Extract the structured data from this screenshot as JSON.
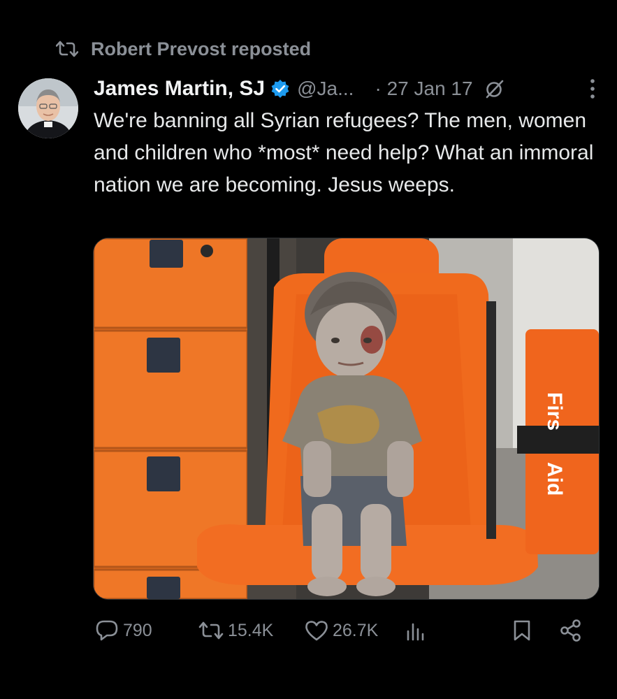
{
  "repost": {
    "label": "Robert Prevost reposted",
    "icon": "repost-icon"
  },
  "tweet": {
    "author_name": "James Martin, SJ",
    "verified": true,
    "handle": "@Ja...",
    "date": "· 27 Jan 17",
    "text": "We're banning all Syrian refugees? The men, women and children who *most* need help? What an immoral nation we are becoming. Jesus weeps.",
    "image": {
      "sign_text_top": "Firs",
      "sign_text_bottom": "Aid"
    }
  },
  "actions": {
    "replies": "790",
    "reposts": "15.4K",
    "likes": "26.7K"
  },
  "colors": {
    "background": "#000000",
    "text": "#e7e9ea",
    "muted": "#8b9097",
    "verified_blue": "#1d9bf0",
    "seat_orange": "#f0691e"
  }
}
